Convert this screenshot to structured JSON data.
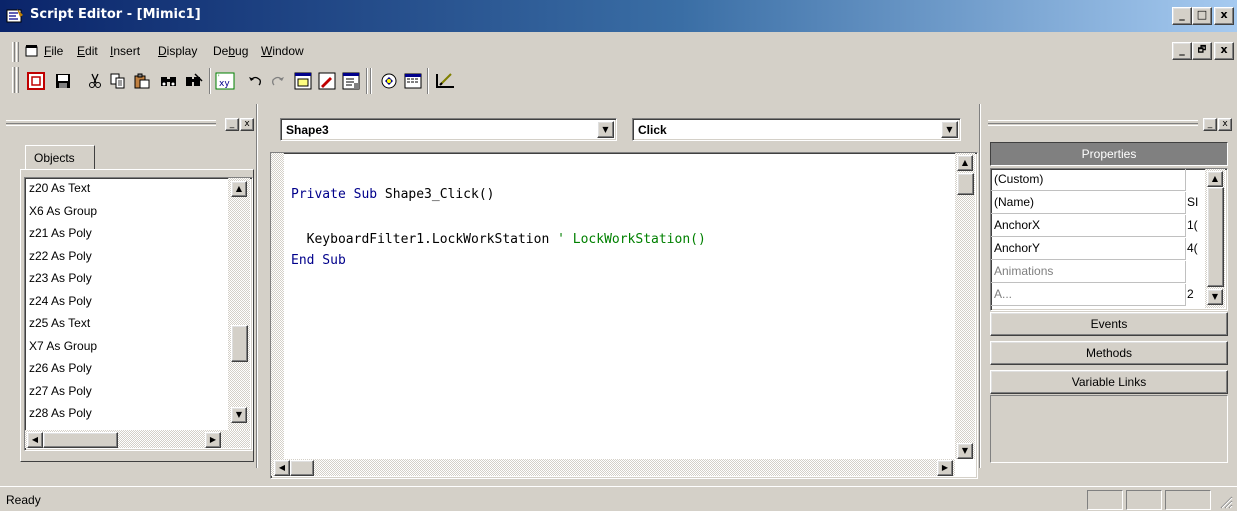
{
  "window": {
    "title": "Script Editor - [Mimic1]",
    "minimize": "_",
    "maximize": "□",
    "close": "x",
    "child_restore": "🗗"
  },
  "menu": {
    "items": [
      "File",
      "Edit",
      "Insert",
      "Display",
      "Debug",
      "Window"
    ],
    "underlined": [
      "F",
      "E",
      "I",
      "D",
      "b",
      "W"
    ]
  },
  "toolbar": {
    "icons": [
      "stop-icon",
      "save-icon",
      "cut-icon",
      "copy-icon",
      "paste-icon",
      "find-icon",
      "replace-icon",
      "variables-icon",
      "undo-icon",
      "redo-icon",
      "object-browser-icon",
      "procedure-icon",
      "properties-icon",
      "compile-icon",
      "dialog-editor-icon",
      "edit-icon"
    ]
  },
  "objects_panel": {
    "tab": "Objects",
    "items": [
      "z20 As Text",
      "X6 As Group",
      "z21 As Poly",
      "z22 As Poly",
      "z23 As Poly",
      "z24 As Poly",
      "z25 As Text",
      "X7 As Group",
      "z26 As Poly",
      "z27 As Poly",
      "z28 As Poly"
    ]
  },
  "editor": {
    "object_select": "Shape3",
    "event_select": "Click",
    "code": {
      "line1_kw": "Private Sub",
      "line1_rest": " Shape3_Click()",
      "line2_code": "  KeyboardFilter1.LockWorkStation ",
      "line2_comment": "' LockWorkStation()",
      "line3": "End Sub"
    }
  },
  "properties_panel": {
    "header": "Properties",
    "rows": [
      {
        "name": "(Custom)",
        "value": ""
      },
      {
        "name": "(Name)",
        "value": "SI"
      },
      {
        "name": "AnchorX",
        "value": "1("
      },
      {
        "name": "AnchorY",
        "value": "4("
      },
      {
        "name": "Animations",
        "value": ""
      },
      {
        "name": "A...",
        "value": "2"
      }
    ],
    "sections": [
      "Events",
      "Methods",
      "Variable Links"
    ]
  },
  "status": {
    "text": "Ready"
  },
  "colors": {
    "title_start": "#0a246a",
    "title_end": "#a6caf0",
    "keyword": "#00008b",
    "comment": "#008000",
    "face": "#d4d0c8"
  }
}
